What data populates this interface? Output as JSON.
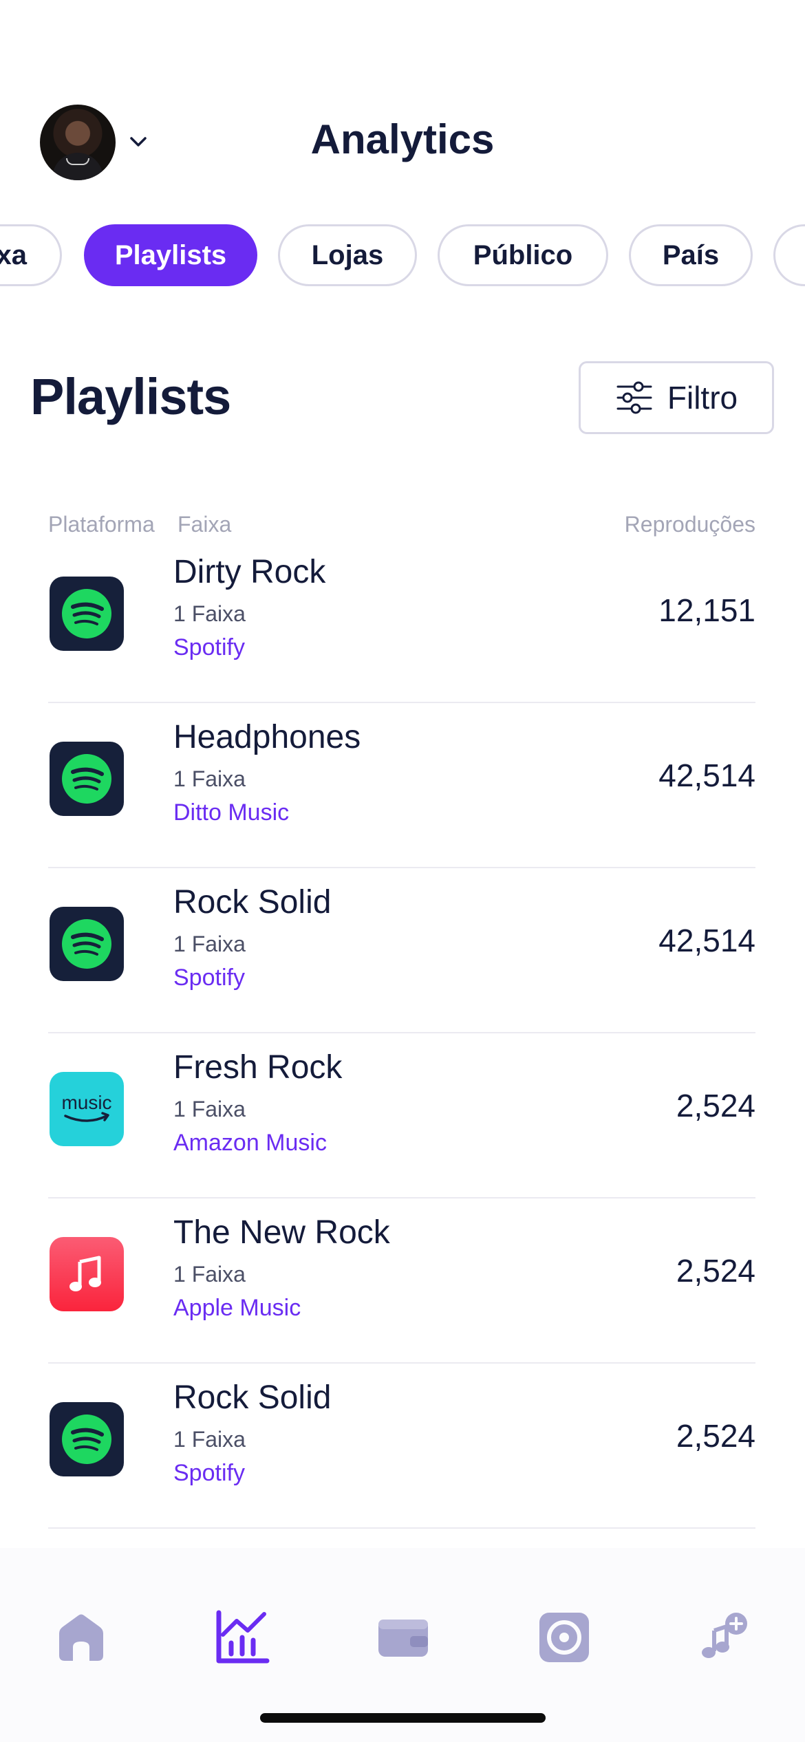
{
  "header": {
    "title": "Analytics"
  },
  "tabs": [
    {
      "label": "Faixa"
    },
    {
      "label": "Playlists",
      "active": true
    },
    {
      "label": "Lojas"
    },
    {
      "label": "Público"
    },
    {
      "label": "País"
    }
  ],
  "section": {
    "title": "Playlists",
    "filter_label": "Filtro"
  },
  "columns": {
    "platform": "Plataforma",
    "track": "Faixa",
    "plays": "Reproduções"
  },
  "rows": [
    {
      "name": "Dirty Rock",
      "count": "1 Faixa",
      "platform": "Spotify",
      "plays": "12,151",
      "icon": "spotify-icon"
    },
    {
      "name": "Headphones",
      "count": "1 Faixa",
      "platform": "Ditto Music",
      "plays": "42,514",
      "icon": "spotify-icon"
    },
    {
      "name": "Rock Solid",
      "count": "1 Faixa",
      "platform": "Spotify",
      "plays": "42,514",
      "icon": "spotify-icon"
    },
    {
      "name": "Fresh Rock",
      "count": "1 Faixa",
      "platform": "Amazon Music",
      "plays": "2,524",
      "icon": "amazon-music-icon"
    },
    {
      "name": "The New Rock",
      "count": "1 Faixa",
      "platform": "Apple Music",
      "plays": "2,524",
      "icon": "apple-music-icon"
    },
    {
      "name": "Rock Solid",
      "count": "1 Faixa",
      "platform": "Spotify",
      "plays": "2,524",
      "icon": "spotify-icon"
    }
  ],
  "amazon_logo_text": "music",
  "nav": [
    {
      "icon": "home-icon"
    },
    {
      "icon": "analytics-icon",
      "active": true
    },
    {
      "icon": "wallet-icon"
    },
    {
      "icon": "disc-icon"
    },
    {
      "icon": "add-music-icon"
    }
  ],
  "colors": {
    "accent": "#6a2cf2",
    "text": "#141b3a",
    "nav_inactive": "#a7a6cf",
    "spotify_green": "#1ed760"
  }
}
